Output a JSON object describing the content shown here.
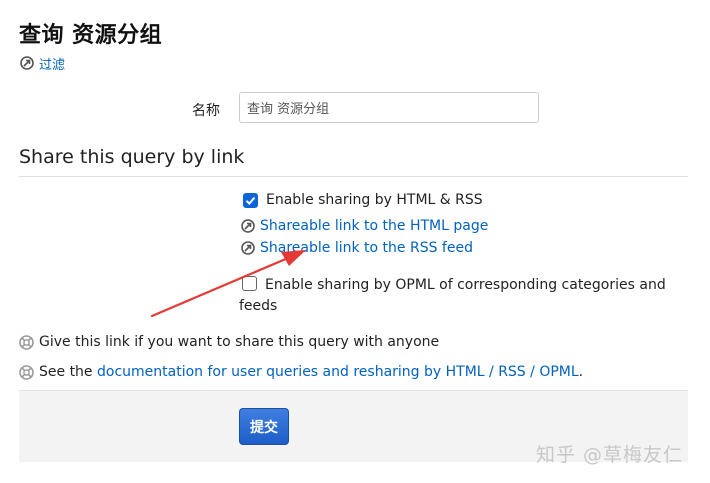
{
  "header": {
    "title": "查询 资源分组",
    "filter_link": "过滤"
  },
  "form": {
    "name_label": "名称",
    "name_value": "查询 资源分组"
  },
  "share": {
    "section_title": "Share this query by link",
    "html_rss_label": "Enable sharing by HTML & RSS",
    "html_rss_checked": true,
    "html_link": "Shareable link to the HTML page",
    "rss_link": "Shareable link to the RSS feed",
    "opml_label": "Enable sharing by OPML of corresponding categories and feeds",
    "opml_checked": false
  },
  "help": {
    "give_link_text": "Give this link if you want to share this query with anyone",
    "see_prefix": "See the ",
    "doc_link": "documentation for user queries and resharing by HTML / RSS / OPML",
    "see_suffix": "."
  },
  "footer": {
    "submit_label": "提交"
  },
  "watermark": "知乎 @草梅友仁",
  "icons": {
    "filter": "link-icon",
    "share_link": "link-icon",
    "help": "help-lifebuoy-icon",
    "annotation": "red-arrow"
  },
  "colors": {
    "link": "#0062be",
    "checkbox_accent": "#0a66d8",
    "button": "#2a6ad4",
    "annotation_arrow": "#e53935",
    "footer_bg": "#f3f3f3"
  }
}
